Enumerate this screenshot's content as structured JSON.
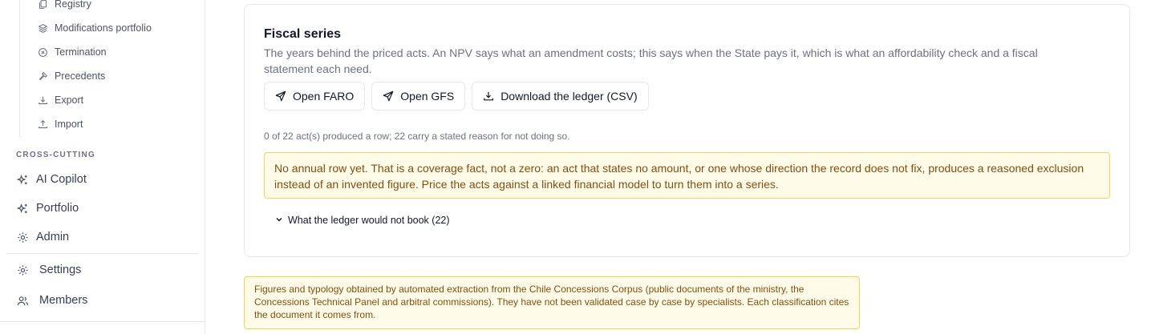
{
  "sidebar": {
    "sub_items": [
      {
        "label": "Registry",
        "icon": "documents-icon"
      },
      {
        "label": "Modifications portfolio",
        "icon": "layers-icon"
      },
      {
        "label": "Termination",
        "icon": "x-circle-icon"
      },
      {
        "label": "Precedents",
        "icon": "gavel-icon"
      },
      {
        "label": "Export",
        "icon": "download-icon"
      },
      {
        "label": "Import",
        "icon": "upload-icon"
      }
    ],
    "section_label": "CROSS-CUTTING",
    "cross_cutting": [
      {
        "label": "AI Copilot",
        "icon": "sparkles-icon"
      },
      {
        "label": "Portfolio",
        "icon": "sparkles-icon"
      },
      {
        "label": "Admin",
        "icon": "gear-icon"
      }
    ],
    "bottom": [
      {
        "label": "Settings",
        "icon": "gear-icon"
      },
      {
        "label": "Members",
        "icon": "users-icon"
      }
    ]
  },
  "fiscal": {
    "title": "Fiscal series",
    "description": "The years behind the priced acts. An NPV says what an amendment costs; this says when the State pays it, which is what an affordability check and a fiscal statement each need.",
    "buttons": {
      "open_faro": "Open FARO",
      "open_gfs": "Open GFS",
      "download": "Download the ledger (CSV)"
    },
    "count_note": "0 of 22 act(s) produced a row; 22 carry a stated reason for not doing so.",
    "alert": "No annual row yet. That is a coverage fact, not a zero: an act that states no amount, or one whose direction the record does not fix, produces a reasoned exclusion instead of an invented figure. Price the acts against a linked financial model to turn them into a series.",
    "disclosure": "What the ledger would not book (22)"
  },
  "footnote": "Figures and typology obtained by automated extraction from the Chile Concessions Corpus (public documents of the ministry, the Concessions Technical Panel and arbitral commissions). They have not been validated case by case by specialists. Each classification cites the document it comes from.",
  "colors": {
    "alert_bg": "#fefce8",
    "alert_border": "#fcd34d",
    "alert_text": "#854d0e"
  }
}
